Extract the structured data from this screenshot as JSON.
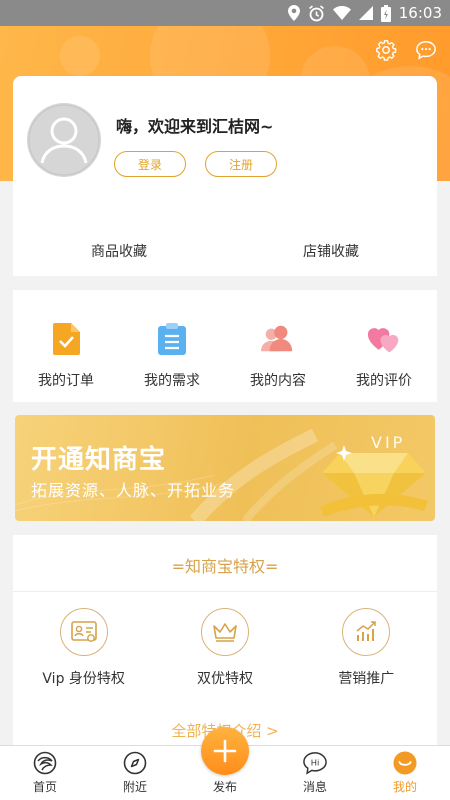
{
  "status_bar": {
    "time": "16:03"
  },
  "header": {
    "settings_icon": "gear-icon",
    "message_icon": "chat-bubble-icon"
  },
  "profile": {
    "greeting": "嗨，欢迎来到汇桔网~",
    "login_label": "登录",
    "register_label": "注册",
    "favorites": [
      {
        "label": "商品收藏"
      },
      {
        "label": "店铺收藏"
      }
    ]
  },
  "quick_menu": {
    "items": [
      {
        "label": "我的订单",
        "icon": "order-icon",
        "color": "#f5a623"
      },
      {
        "label": "我的需求",
        "icon": "clipboard-icon",
        "color": "#5ab1ef"
      },
      {
        "label": "我的内容",
        "icon": "people-icon",
        "color": "#f08a7e"
      },
      {
        "label": "我的评价",
        "icon": "hearts-icon",
        "color": "#f27aa0"
      }
    ]
  },
  "banner": {
    "title": "开通知商宝",
    "subtitle": "拓展资源、人脉、开拓业务",
    "vip": "VIP"
  },
  "privileges": {
    "title": "知商宝特权",
    "items": [
      {
        "label": "Vip 身份特权",
        "icon": "id-card-icon"
      },
      {
        "label": "双优特权",
        "icon": "crown-icon"
      },
      {
        "label": "营销推广",
        "icon": "growth-chart-icon"
      }
    ],
    "more_label": "全部特权介绍 >"
  },
  "bottom_nav": {
    "items": [
      {
        "label": "首页",
        "icon": "home-icon"
      },
      {
        "label": "附近",
        "icon": "compass-icon"
      },
      {
        "label": "发布",
        "icon": "plus-icon"
      },
      {
        "label": "消息",
        "icon": "hi-bubble-icon"
      },
      {
        "label": "我的",
        "icon": "smile-icon"
      }
    ],
    "active_index": 4,
    "accent_color": "#f39a25"
  }
}
